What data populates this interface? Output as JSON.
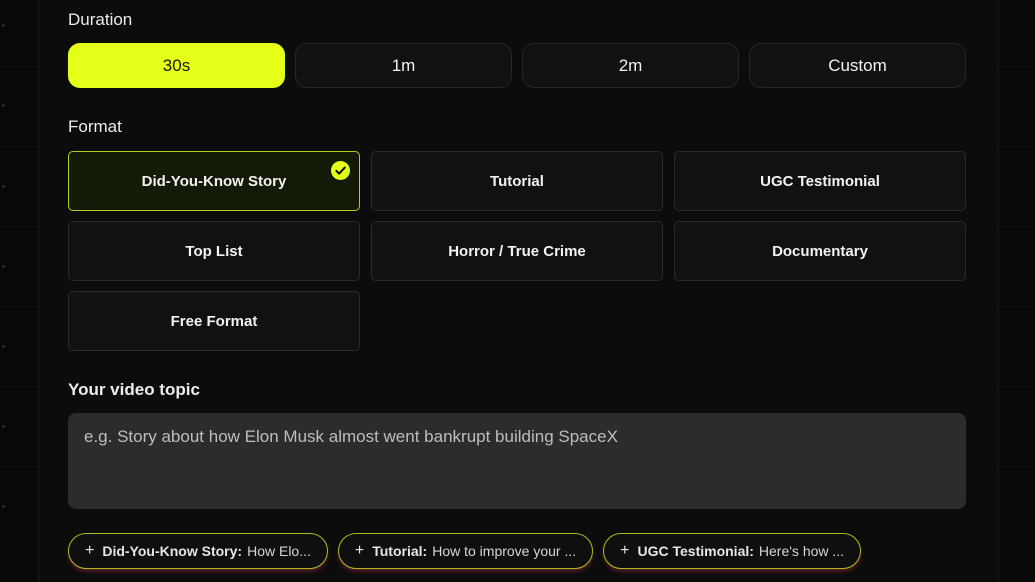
{
  "duration": {
    "label": "Duration",
    "options": [
      {
        "label": "30s",
        "selected": true
      },
      {
        "label": "1m",
        "selected": false
      },
      {
        "label": "2m",
        "selected": false
      },
      {
        "label": "Custom",
        "selected": false
      }
    ]
  },
  "format": {
    "label": "Format",
    "options": [
      {
        "label": "Did-You-Know Story",
        "selected": true
      },
      {
        "label": "Tutorial",
        "selected": false
      },
      {
        "label": "UGC Testimonial",
        "selected": false
      },
      {
        "label": "Top List",
        "selected": false
      },
      {
        "label": "Horror / True Crime",
        "selected": false
      },
      {
        "label": "Documentary",
        "selected": false
      },
      {
        "label": "Free Format",
        "selected": false
      }
    ]
  },
  "topic": {
    "label": "Your video topic",
    "value": "",
    "placeholder": "e.g. Story about how Elon Musk almost went bankrupt building SpaceX"
  },
  "suggestions": [
    {
      "icon": "plus-icon",
      "format": "Did-You-Know Story:",
      "text": "How Elo..."
    },
    {
      "icon": "plus-icon",
      "format": "Tutorial:",
      "text": "How to improve your ..."
    },
    {
      "icon": "plus-icon",
      "format": "UGC Testimonial:",
      "text": "Here's how ..."
    }
  ],
  "colors": {
    "accent": "#e4ff18",
    "background": "#0c0c0c",
    "input_background": "#2c2c2c",
    "chip_border": "#a8bd20"
  }
}
